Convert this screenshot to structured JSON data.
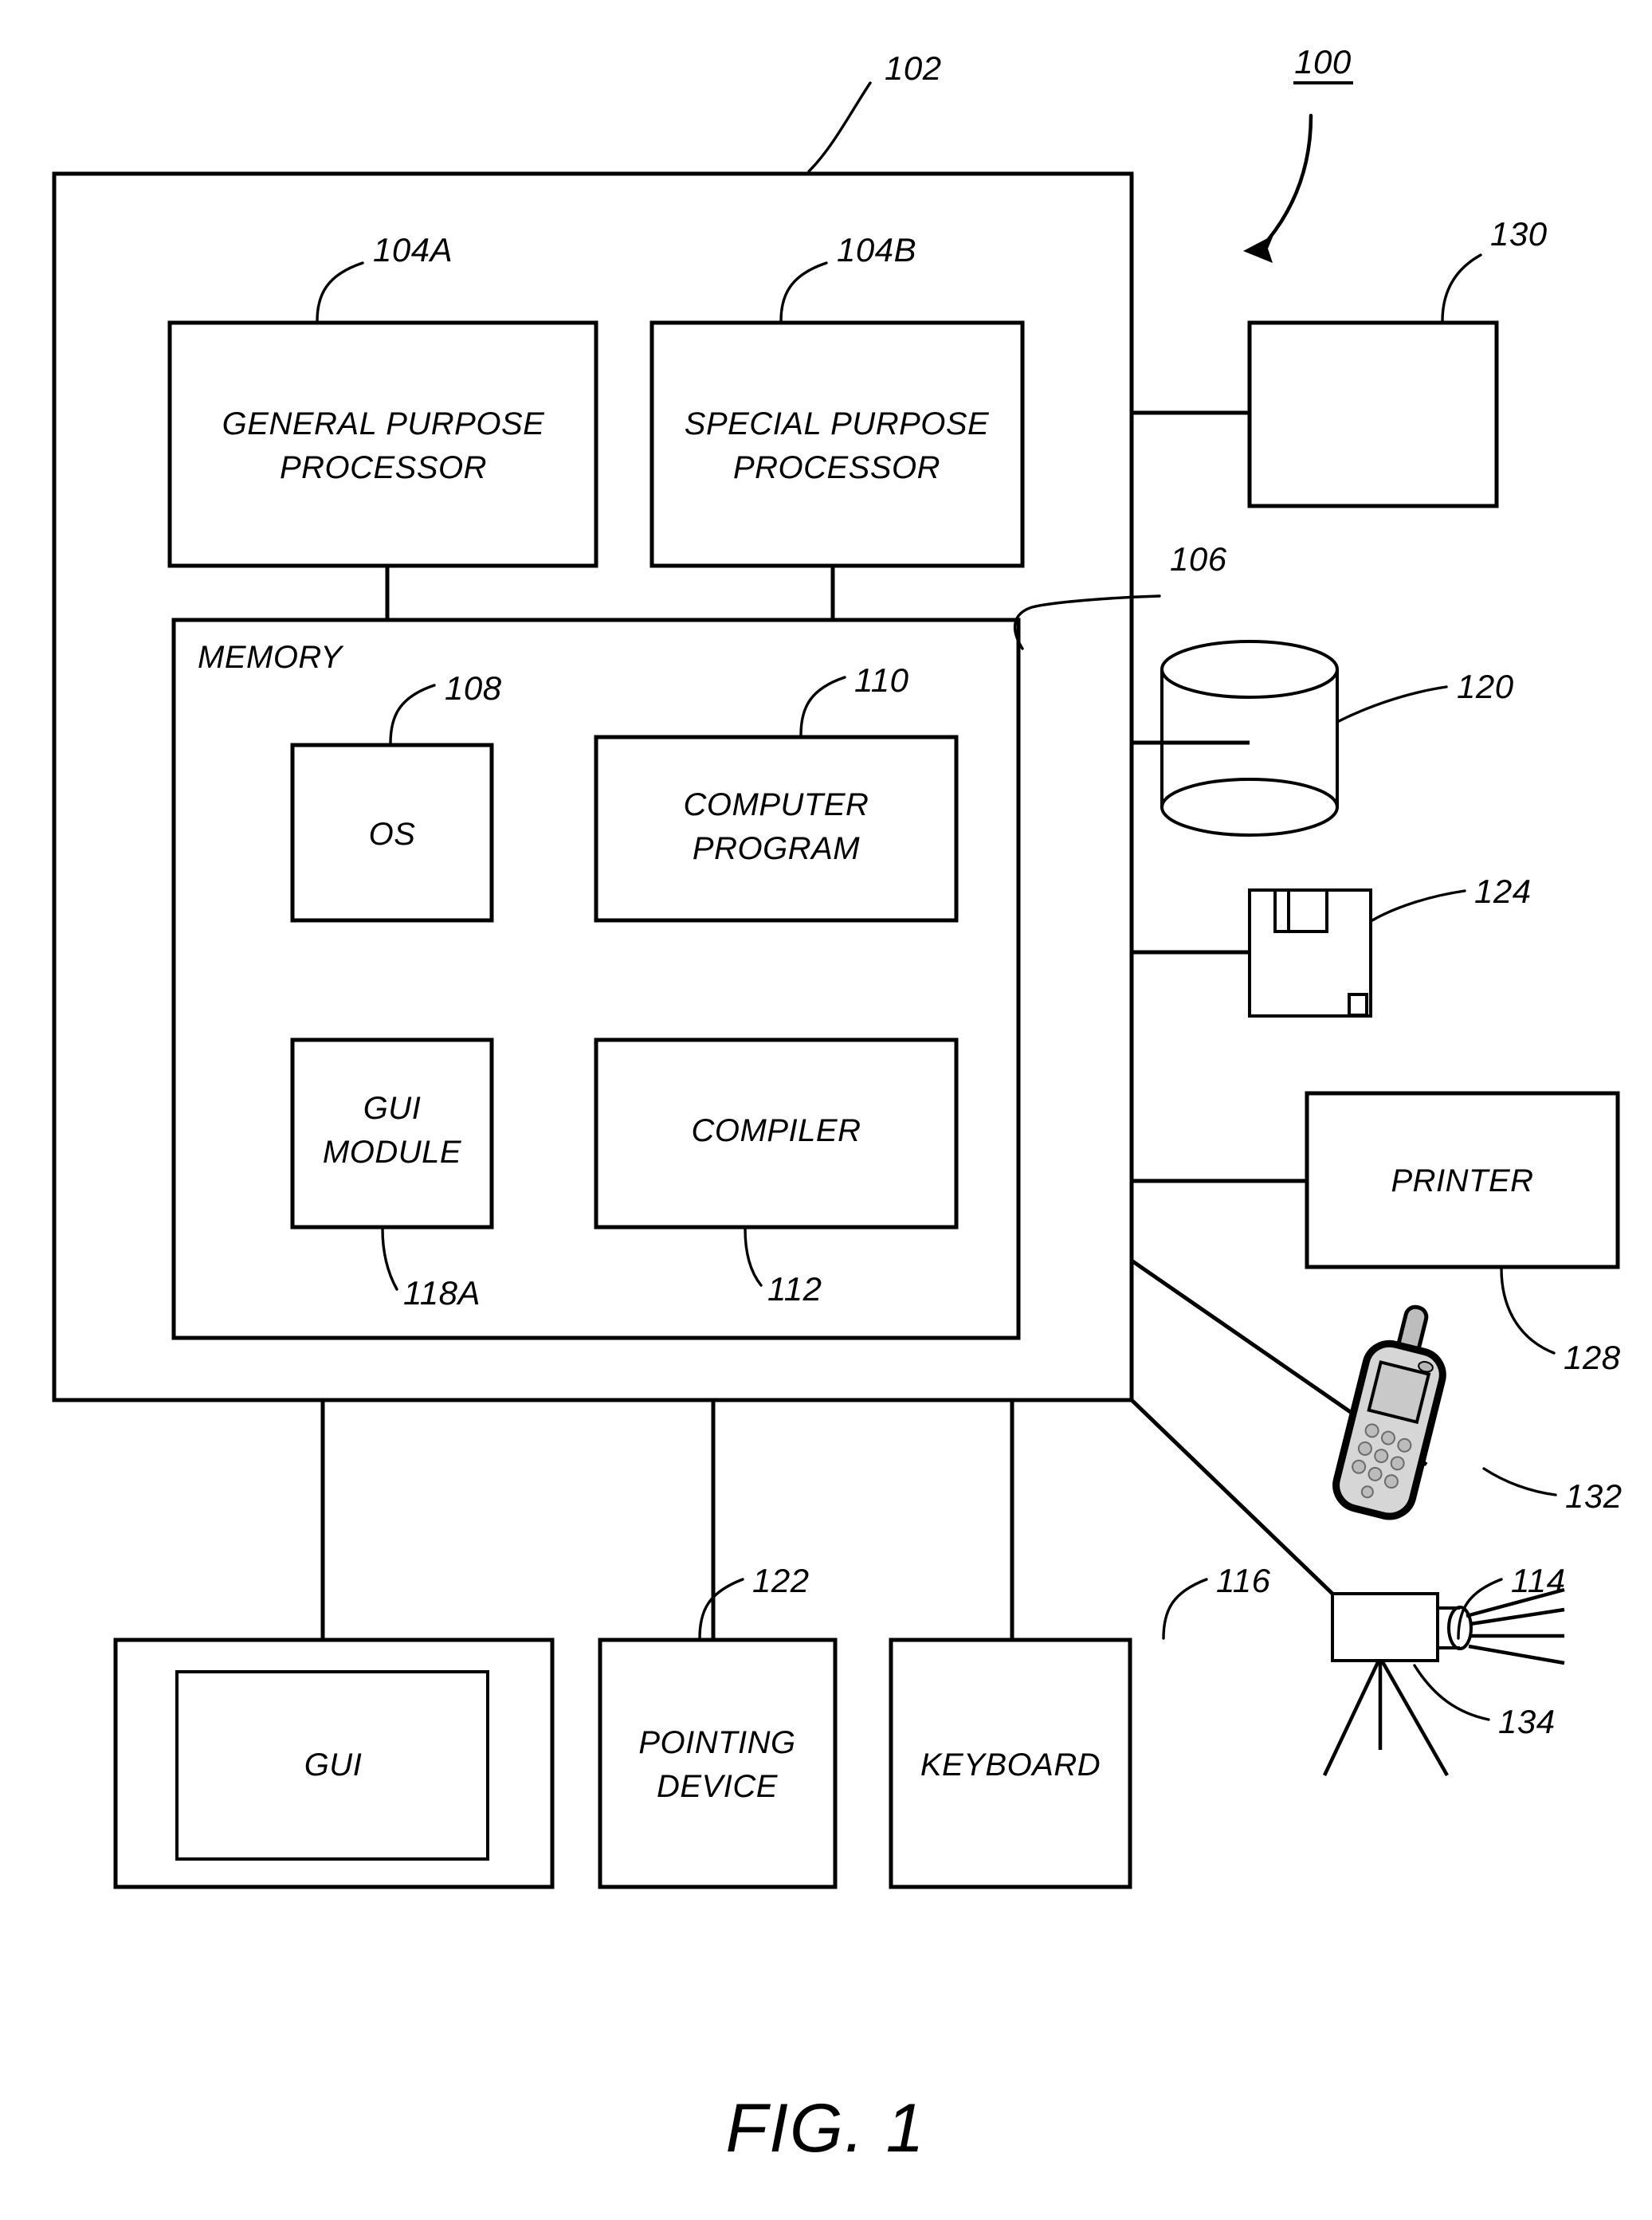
{
  "figure": {
    "caption": "FIG. 1",
    "system_ref": "100"
  },
  "computer": {
    "ref": "102",
    "memory": {
      "label": "MEMORY",
      "ref": "106",
      "modules": [
        {
          "label": "OS",
          "ref": "108"
        },
        {
          "label": "COMPUTER\nPROGRAM",
          "line1": "COMPUTER",
          "line2": "PROGRAM",
          "ref": "110"
        },
        {
          "label": "GUI\nMODULE",
          "line1": "GUI",
          "line2": "MODULE",
          "ref": "118A"
        },
        {
          "label": "COMPILER",
          "line1": "COMPILER",
          "line2": "",
          "ref": "112"
        }
      ]
    },
    "processors": [
      {
        "line1": "GENERAL PURPOSE",
        "line2": "PROCESSOR",
        "ref": "104A"
      },
      {
        "line1": "SPECIAL PURPOSE",
        "line2": "PROCESSOR",
        "ref": "104B"
      }
    ]
  },
  "peripherals_right": [
    {
      "name": "blank-device",
      "label": "",
      "ref": "130",
      "shape": "rectangle"
    },
    {
      "name": "data-storage",
      "label": "",
      "ref": "120",
      "shape": "cylinder"
    },
    {
      "name": "removable-media",
      "label": "",
      "ref": "124",
      "shape": "floppy-disk"
    },
    {
      "name": "printer",
      "label": "PRINTER",
      "ref": "128",
      "shape": "rectangle"
    },
    {
      "name": "mobile-phone",
      "label": "",
      "ref": "132",
      "shape": "phone"
    },
    {
      "name": "camera-projector",
      "label": "",
      "ref": "134",
      "shape": "camera"
    }
  ],
  "peripherals_bottom": [
    {
      "name": "gui-display",
      "label": "GUI",
      "ref": "122"
    },
    {
      "name": "pointing-device",
      "line1": "POINTING",
      "line2": "DEVICE",
      "ref": "116"
    },
    {
      "name": "keyboard",
      "label": "KEYBOARD",
      "ref": "114"
    }
  ],
  "colors": {
    "ink": "#000000",
    "paper": "#ffffff",
    "phone_body": "#d6d6d6"
  }
}
